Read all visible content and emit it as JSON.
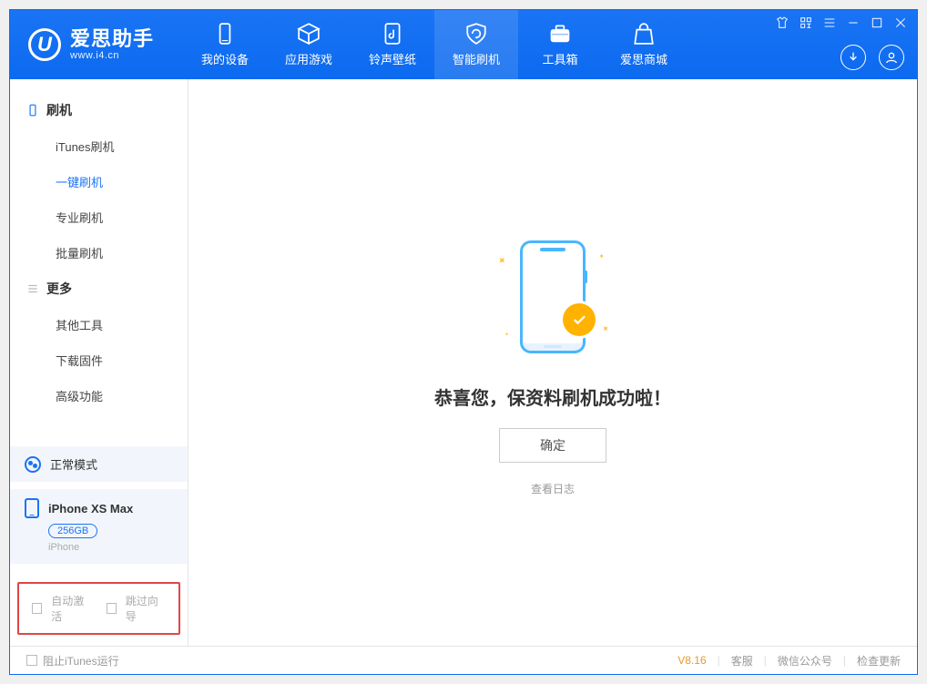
{
  "brand": {
    "name": "爱思助手",
    "url": "www.i4.cn"
  },
  "nav": {
    "items": [
      {
        "label": "我的设备"
      },
      {
        "label": "应用游戏"
      },
      {
        "label": "铃声壁纸"
      },
      {
        "label": "智能刷机"
      },
      {
        "label": "工具箱"
      },
      {
        "label": "爱思商城"
      }
    ],
    "active_index": 3
  },
  "sidebar": {
    "group_flash": {
      "title": "刷机",
      "items": [
        "iTunes刷机",
        "一键刷机",
        "专业刷机",
        "批量刷机"
      ],
      "active_index": 1
    },
    "group_more": {
      "title": "更多",
      "items": [
        "其他工具",
        "下载固件",
        "高级功能"
      ]
    },
    "status_label": "正常模式",
    "device": {
      "name": "iPhone XS Max",
      "capacity": "256GB",
      "type": "iPhone"
    },
    "options": {
      "auto_activate": "自动激活",
      "skip_wizard": "跳过向导"
    }
  },
  "main": {
    "success_msg": "恭喜您，保资料刷机成功啦！",
    "ok_label": "确定",
    "log_link_label": "查看日志"
  },
  "footer": {
    "block_itunes": "阻止iTunes运行",
    "version": "V8.16",
    "links": [
      "客服",
      "微信公众号",
      "检查更新"
    ]
  },
  "colors": {
    "primary": "#1a74f4",
    "warn_highlight": "#e04646"
  }
}
